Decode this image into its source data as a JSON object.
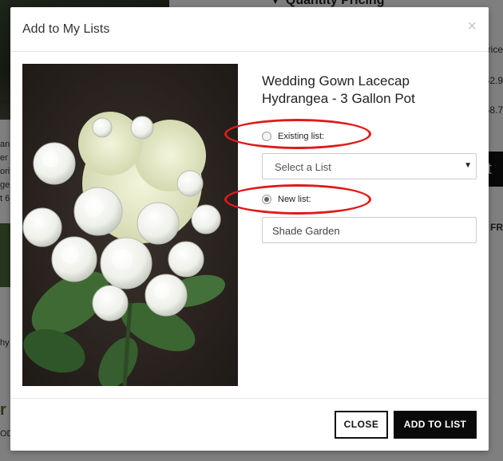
{
  "background": {
    "heading": "Quantity Pricing",
    "side_lines": [
      "an",
      "er s",
      "ori",
      "ge",
      "t 6",
      "hy",
      "OD"
    ],
    "right_labels": [
      "rice",
      "62.9",
      "58.7"
    ],
    "button_glyph": "t",
    "fr_label": "FR",
    "ev_label": "ve",
    "green_text": "r"
  },
  "modal": {
    "title": "Add to My Lists",
    "close_glyph": "×",
    "product_name": "Wedding Gown Lacecap Hydrangea - 3 Gallon Pot",
    "existing_list": {
      "label": "Existing list:",
      "selected": false
    },
    "select": {
      "value": "Select a List",
      "arrow": "▼"
    },
    "new_list": {
      "label": "New list:",
      "selected": true
    },
    "new_list_input": {
      "value": "Shade Garden"
    },
    "buttons": {
      "close": "CLOSE",
      "add": "ADD TO LIST"
    }
  },
  "colors": {
    "highlight": "#e01a1a",
    "primary_button": "#0a0a0a"
  }
}
